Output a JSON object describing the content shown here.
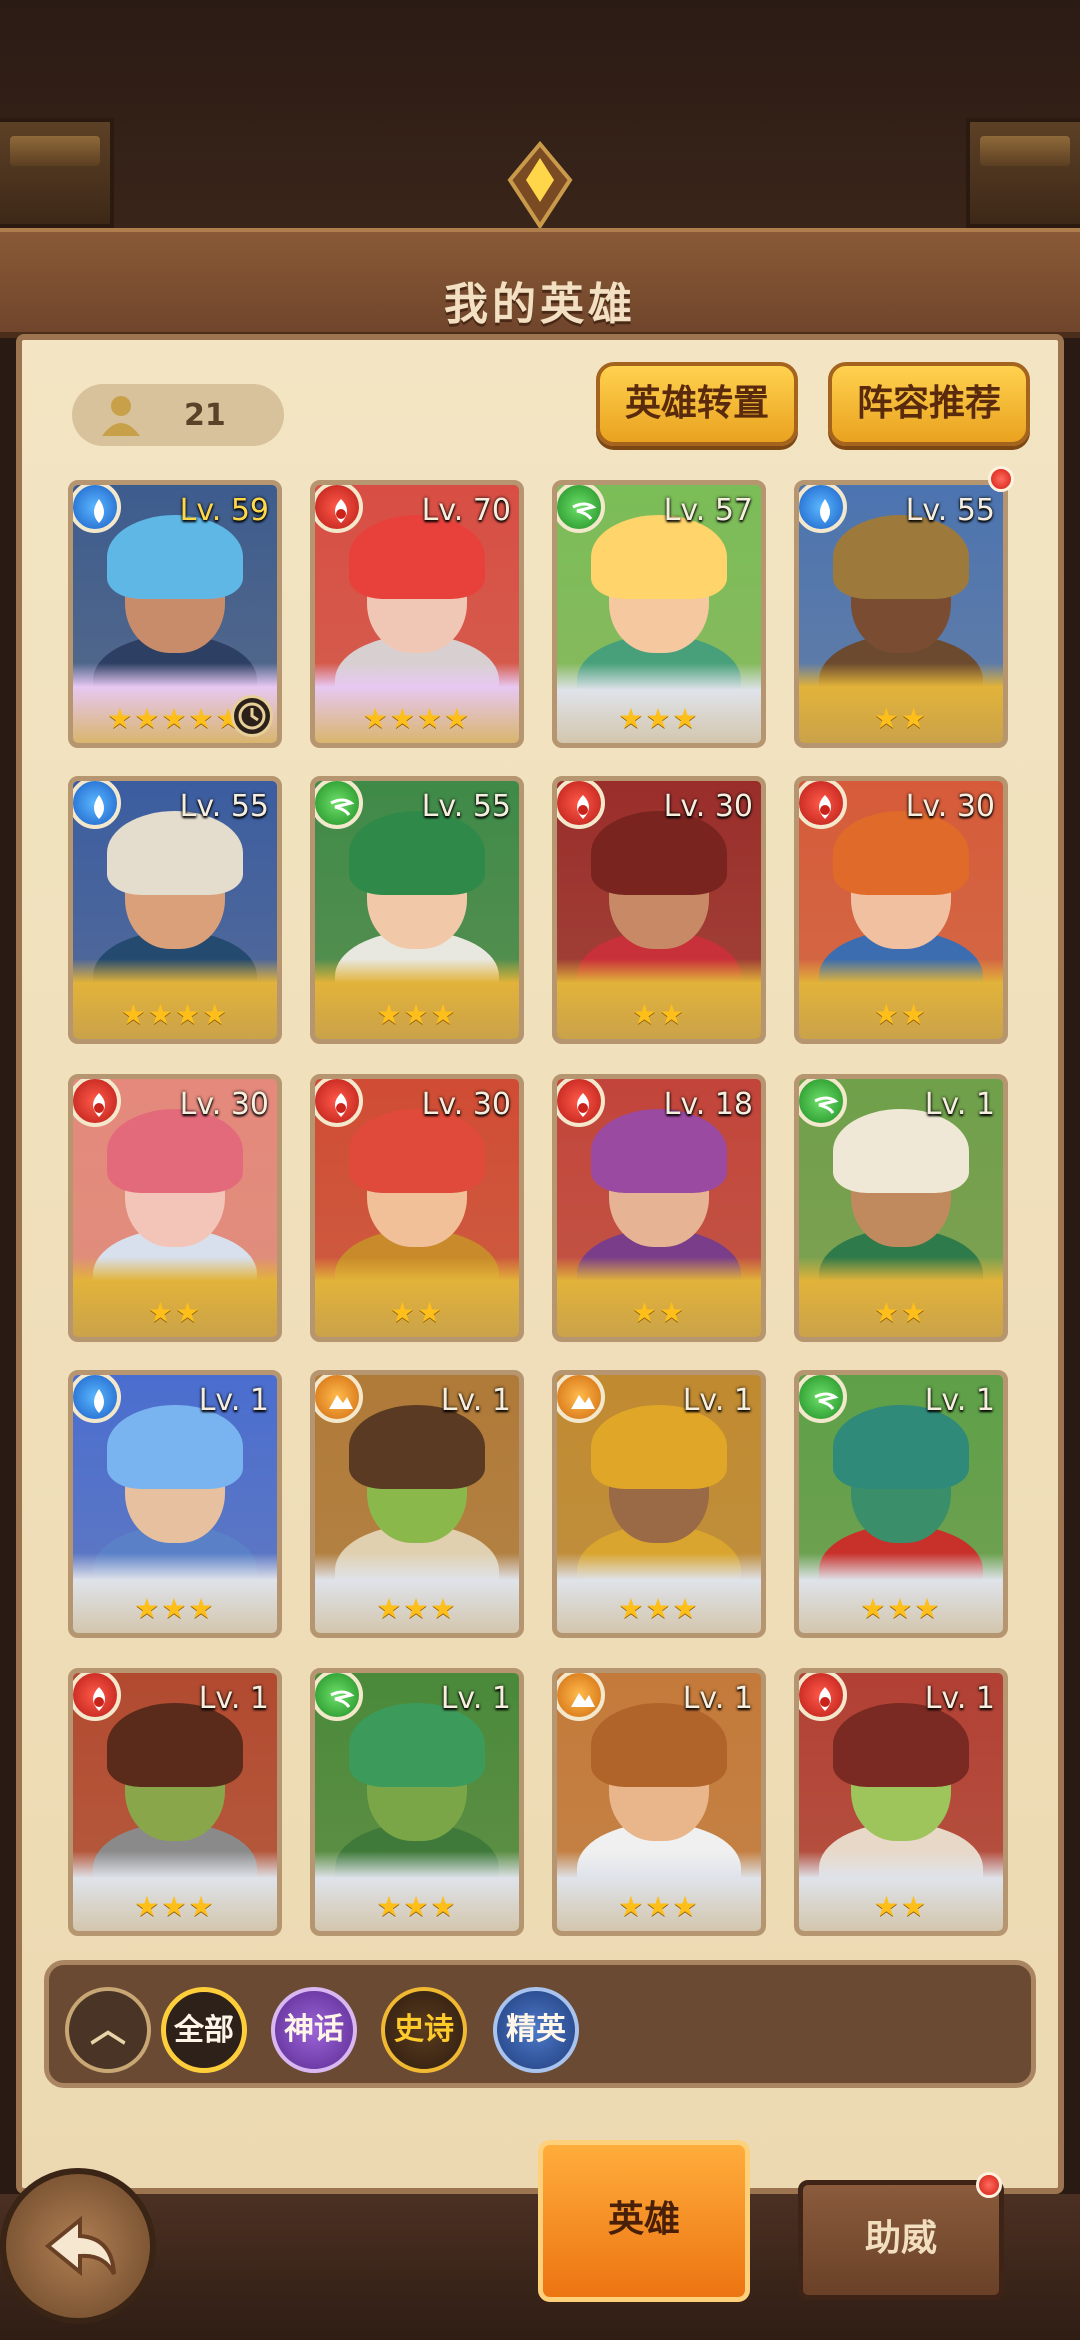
{
  "header": {
    "title": "我的英雄"
  },
  "hero_count": "21",
  "buttons": {
    "transfer": "英雄转置",
    "lineup": "阵容推荐"
  },
  "heroes": [
    {
      "level": "Lv. 59",
      "element": "water",
      "stars": "★★★★★",
      "frame": "purple",
      "hair": "#5fb7e6",
      "skin": "#c98c6a",
      "bg": "#3d5c8e",
      "cloth": "#2d3f63",
      "timer": true
    },
    {
      "level": "Lv. 70",
      "element": "fire",
      "stars": "★★★★",
      "frame": "purple",
      "hair": "#e8413c",
      "skin": "#f0c7b5",
      "bg": "#d84e44",
      "cloth": "#d8d0d0"
    },
    {
      "level": "Lv. 57",
      "element": "wind",
      "stars": "★★★",
      "frame": "silver",
      "hair": "#ffd46a",
      "skin": "#f5c8a0",
      "bg": "#7bbd58",
      "cloth": "#48a07a"
    },
    {
      "level": "Lv. 55",
      "element": "water",
      "stars": "★★",
      "frame": "gold",
      "hair": "#9d7a3c",
      "skin": "#7a4d33",
      "bg": "#4c74b0",
      "cloth": "#6b4a30",
      "dot": true
    },
    {
      "level": "Lv. 55",
      "element": "water",
      "stars": "★★★★",
      "frame": "gold",
      "hair": "#e4dccc",
      "skin": "#d9a079",
      "bg": "#3b5da0",
      "cloth": "#244a70"
    },
    {
      "level": "Lv. 55",
      "element": "wind",
      "stars": "★★★",
      "frame": "gold",
      "hair": "#2f8a4a",
      "skin": "#f1c9a8",
      "bg": "#3f8a48",
      "cloth": "#e8e8e0"
    },
    {
      "level": "Lv. 30",
      "element": "fire",
      "stars": "★★",
      "frame": "gold",
      "hair": "#7a2420",
      "skin": "#c88a66",
      "bg": "#9a2d2a",
      "cloth": "#c8303a"
    },
    {
      "level": "Lv. 30",
      "element": "fire",
      "stars": "★★",
      "frame": "gold",
      "hair": "#e06a2a",
      "skin": "#f0c0a0",
      "bg": "#d65b3a",
      "cloth": "#3b6db0"
    },
    {
      "level": "Lv. 30",
      "element": "fire",
      "stars": "★★",
      "frame": "gold",
      "hair": "#e36a7a",
      "skin": "#f3c4b8",
      "bg": "#e5897c",
      "cloth": "#d8e0ee"
    },
    {
      "level": "Lv. 30",
      "element": "fire",
      "stars": "★★",
      "frame": "gold",
      "hair": "#e04a3a",
      "skin": "#f1bf98",
      "bg": "#d04c34",
      "cloth": "#c88a2a"
    },
    {
      "level": "Lv. 18",
      "element": "fire",
      "stars": "★★",
      "frame": "gold",
      "hair": "#9a4aa0",
      "skin": "#e6b494",
      "bg": "#c2443a",
      "cloth": "#7a3d8a"
    },
    {
      "level": "Lv. 1",
      "element": "wind",
      "stars": "★★",
      "frame": "gold",
      "hair": "#f0e8d6",
      "skin": "#c08a5e",
      "bg": "#6fa04a",
      "cloth": "#2f7a4a"
    },
    {
      "level": "Lv. 1",
      "element": "water",
      "stars": "★★★",
      "frame": "silver",
      "hair": "#7ab4f0",
      "skin": "#e7c0a0",
      "bg": "#4a6ed0",
      "cloth": "#5a80c8"
    },
    {
      "level": "Lv. 1",
      "element": "earth",
      "stars": "★★★",
      "frame": "silver",
      "hair": "#5a3a22",
      "skin": "#8ab84a",
      "bg": "#b07a38",
      "cloth": "#e0d0b0"
    },
    {
      "level": "Lv. 1",
      "element": "earth",
      "stars": "★★★",
      "frame": "silver",
      "hair": "#e0a628",
      "skin": "#9a6a46",
      "bg": "#c08a30",
      "cloth": "#d9a52e"
    },
    {
      "level": "Lv. 1",
      "element": "wind",
      "stars": "★★★",
      "frame": "silver",
      "hair": "#2f8a7a",
      "skin": "#3a8e6a",
      "bg": "#5ea048",
      "cloth": "#c8302a"
    },
    {
      "level": "Lv. 1",
      "element": "fire",
      "stars": "★★★",
      "frame": "silver",
      "hair": "#5a2a1a",
      "skin": "#8aa64a",
      "bg": "#b24a30",
      "cloth": "#8a8a8a"
    },
    {
      "level": "Lv. 1",
      "element": "wind",
      "stars": "★★★",
      "frame": "silver",
      "hair": "#3c9a5a",
      "skin": "#7aa648",
      "bg": "#4a8a3a",
      "cloth": "#3f7a3a"
    },
    {
      "level": "Lv. 1",
      "element": "earth",
      "stars": "★★★",
      "frame": "silver",
      "hair": "#b0642a",
      "skin": "#e9b58a",
      "bg": "#c47a3a",
      "cloth": "#f0f0f0"
    },
    {
      "level": "Lv. 1",
      "element": "fire",
      "stars": "★★",
      "frame": "silver",
      "hair": "#7a2a22",
      "skin": "#9ec45c",
      "bg": "#b24034",
      "cloth": "#e8d8c8"
    }
  ],
  "filters": {
    "all": "全部",
    "myth": "神话",
    "epic": "史诗",
    "elite": "精英"
  },
  "tabs": {
    "hero": "英雄",
    "assist": "助威"
  }
}
